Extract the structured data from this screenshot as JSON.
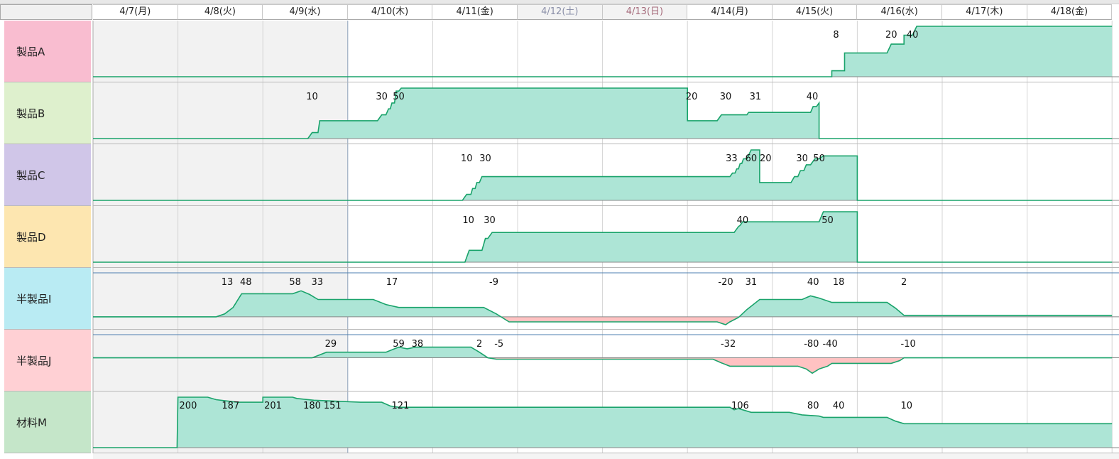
{
  "days": [
    {
      "label": "4/7(月)",
      "type": "weekday"
    },
    {
      "label": "4/8(火)",
      "type": "weekday"
    },
    {
      "label": "4/9(水)",
      "type": "weekday"
    },
    {
      "label": "4/10(木)",
      "type": "weekday"
    },
    {
      "label": "4/11(金)",
      "type": "weekday"
    },
    {
      "label": "4/12(土)",
      "type": "sat"
    },
    {
      "label": "4/13(日)",
      "type": "sun"
    },
    {
      "label": "4/14(月)",
      "type": "weekday"
    },
    {
      "label": "4/15(火)",
      "type": "weekday"
    },
    {
      "label": "4/16(水)",
      "type": "weekday"
    },
    {
      "label": "4/17(木)",
      "type": "weekday"
    },
    {
      "label": "4/18(金)",
      "type": "weekday"
    }
  ],
  "past_days": 3,
  "colors": {
    "positive_fill": "#ade5d6",
    "negative_fill": "#ffc2c2",
    "line": "#1aa36b",
    "past_bg": "#f2f2f2",
    "grid": "#d4d4d4"
  },
  "rows": [
    {
      "id": "product-a",
      "name": "製品A",
      "color": "#f9bdd0",
      "baseline_zero": true,
      "series": [
        [
          0,
          0
        ],
        [
          8.7,
          0
        ],
        [
          8.7,
          1
        ],
        [
          8.85,
          1
        ],
        [
          8.85,
          4
        ],
        [
          9.35,
          4
        ],
        [
          9.4,
          5.5
        ],
        [
          9.55,
          5.5
        ],
        [
          9.55,
          7
        ],
        [
          9.65,
          7
        ],
        [
          9.7,
          8.5
        ],
        [
          12,
          8.5
        ]
      ],
      "labels": [
        {
          "t": "8",
          "x": 8.75,
          "v": 8.5
        },
        {
          "t": "20",
          "x": 9.4,
          "v": 8.5
        },
        {
          "t": "40",
          "x": 9.65,
          "v": 8.5
        }
      ]
    },
    {
      "id": "product-b",
      "name": "製品B",
      "color": "#def0cd",
      "baseline_zero": true,
      "series": [
        [
          0,
          0
        ],
        [
          2.53,
          0
        ],
        [
          2.58,
          1
        ],
        [
          2.65,
          1
        ],
        [
          2.67,
          3
        ],
        [
          3.35,
          3
        ],
        [
          3.4,
          4
        ],
        [
          3.45,
          4
        ],
        [
          3.48,
          5
        ],
        [
          3.5,
          5
        ],
        [
          3.52,
          6
        ],
        [
          3.55,
          6
        ],
        [
          3.57,
          8
        ],
        [
          3.6,
          8
        ],
        [
          3.63,
          8.5
        ],
        [
          7,
          8.5
        ],
        [
          7,
          3
        ],
        [
          7.35,
          3
        ],
        [
          7.4,
          4
        ],
        [
          7.7,
          4
        ],
        [
          7.72,
          4.4
        ],
        [
          8.45,
          4.4
        ],
        [
          8.48,
          5.4
        ],
        [
          8.52,
          5.4
        ],
        [
          8.55,
          6
        ],
        [
          8.55,
          0
        ],
        [
          12,
          0
        ]
      ],
      "labels": [
        {
          "t": "10",
          "x": 2.58,
          "v": 8.5
        },
        {
          "t": "30",
          "x": 3.4,
          "v": 8.5
        },
        {
          "t": "50",
          "x": 3.6,
          "v": 8.5
        },
        {
          "t": "20",
          "x": 7.05,
          "v": 8.5
        },
        {
          "t": "30",
          "x": 7.45,
          "v": 8.5
        },
        {
          "t": "31",
          "x": 7.8,
          "v": 8.5
        },
        {
          "t": "40",
          "x": 8.47,
          "v": 8.5
        }
      ]
    },
    {
      "id": "product-c",
      "name": "製品C",
      "color": "#d0c6e8",
      "baseline_zero": true,
      "series": [
        [
          0,
          0
        ],
        [
          4.35,
          0
        ],
        [
          4.4,
          1
        ],
        [
          4.45,
          1
        ],
        [
          4.47,
          2
        ],
        [
          4.5,
          2
        ],
        [
          4.52,
          3
        ],
        [
          4.55,
          3
        ],
        [
          4.58,
          4
        ],
        [
          7.5,
          4
        ],
        [
          7.53,
          4.6
        ],
        [
          7.56,
          4.6
        ],
        [
          7.58,
          5.3
        ],
        [
          7.6,
          5.3
        ],
        [
          7.62,
          6.2
        ],
        [
          7.64,
          6.2
        ],
        [
          7.66,
          7
        ],
        [
          7.7,
          7
        ],
        [
          7.75,
          8.5
        ],
        [
          7.85,
          8.5
        ],
        [
          7.85,
          3
        ],
        [
          8.22,
          3
        ],
        [
          8.26,
          4
        ],
        [
          8.3,
          4
        ],
        [
          8.33,
          5
        ],
        [
          8.37,
          5
        ],
        [
          8.4,
          6
        ],
        [
          8.45,
          6
        ],
        [
          8.5,
          7
        ],
        [
          8.55,
          7
        ],
        [
          8.6,
          7.5
        ],
        [
          9,
          7.5
        ],
        [
          9,
          0
        ],
        [
          12,
          0
        ]
      ],
      "labels": [
        {
          "t": "10",
          "x": 4.4,
          "v": 8.5
        },
        {
          "t": "30",
          "x": 4.62,
          "v": 8.5
        },
        {
          "t": "33",
          "x": 7.52,
          "v": 8.5
        },
        {
          "t": "60",
          "x": 7.75,
          "v": 8.5
        },
        {
          "t": "20",
          "x": 7.92,
          "v": 8.5
        },
        {
          "t": "30",
          "x": 8.35,
          "v": 8.5
        },
        {
          "t": "50",
          "x": 8.55,
          "v": 8.5
        }
      ]
    },
    {
      "id": "product-d",
      "name": "製品D",
      "color": "#fde6b0",
      "baseline_zero": true,
      "series": [
        [
          0,
          0
        ],
        [
          4.38,
          0
        ],
        [
          4.43,
          2
        ],
        [
          4.58,
          2
        ],
        [
          4.62,
          4
        ],
        [
          4.65,
          4
        ],
        [
          4.7,
          5
        ],
        [
          7.55,
          5
        ],
        [
          7.6,
          6
        ],
        [
          7.62,
          6.2
        ],
        [
          7.65,
          6.8
        ],
        [
          8.55,
          6.8
        ],
        [
          8.6,
          8.5
        ],
        [
          9,
          8.5
        ],
        [
          9,
          0
        ],
        [
          12,
          0
        ]
      ],
      "labels": [
        {
          "t": "10",
          "x": 4.42,
          "v": 8.5
        },
        {
          "t": "30",
          "x": 4.67,
          "v": 8.5
        },
        {
          "t": "40",
          "x": 7.65,
          "v": 8.5
        },
        {
          "t": "50",
          "x": 8.65,
          "v": 8.5
        }
      ]
    },
    {
      "id": "semi-i",
      "name": "半製品I",
      "color": "#b9ebf3",
      "baseline_zero": false,
      "vmin": -10,
      "vmax": 60,
      "series": [
        [
          0,
          0
        ],
        [
          1.45,
          0
        ],
        [
          1.55,
          4
        ],
        [
          1.65,
          13
        ],
        [
          1.75,
          32
        ],
        [
          2.35,
          32
        ],
        [
          2.45,
          36
        ],
        [
          2.55,
          31
        ],
        [
          2.65,
          24
        ],
        [
          3.3,
          24
        ],
        [
          3.45,
          17
        ],
        [
          3.6,
          13
        ],
        [
          4.6,
          13
        ],
        [
          4.75,
          4
        ],
        [
          4.9,
          -7
        ],
        [
          7.35,
          -7
        ],
        [
          7.4,
          -9
        ],
        [
          7.45,
          -11
        ],
        [
          7.5,
          -7
        ],
        [
          7.6,
          -1
        ],
        [
          7.7,
          10
        ],
        [
          7.85,
          24
        ],
        [
          8.35,
          24
        ],
        [
          8.45,
          29
        ],
        [
          8.55,
          26
        ],
        [
          8.7,
          20
        ],
        [
          9.35,
          20
        ],
        [
          9.45,
          12
        ],
        [
          9.55,
          2
        ],
        [
          12,
          2
        ]
      ],
      "labels": [
        {
          "t": "13",
          "x": 1.58,
          "v": 60
        },
        {
          "t": "48",
          "x": 1.8,
          "v": 60
        },
        {
          "t": "58",
          "x": 2.38,
          "v": 60
        },
        {
          "t": "33",
          "x": 2.64,
          "v": 60
        },
        {
          "t": "17",
          "x": 3.52,
          "v": 60
        },
        {
          "t": "-9",
          "x": 4.72,
          "v": 60
        },
        {
          "t": "-20",
          "x": 7.45,
          "v": 60
        },
        {
          "t": "31",
          "x": 7.75,
          "v": 60
        },
        {
          "t": "40",
          "x": 8.48,
          "v": 60
        },
        {
          "t": "18",
          "x": 8.78,
          "v": 60
        },
        {
          "t": "2",
          "x": 9.55,
          "v": 60
        }
      ]
    },
    {
      "id": "semi-j",
      "name": "半製品J",
      "color": "#ffd0d4",
      "baseline_zero": false,
      "vmin": -100,
      "vmax": 80,
      "series": [
        [
          0,
          0
        ],
        [
          2.58,
          0
        ],
        [
          2.75,
          20
        ],
        [
          3.45,
          20
        ],
        [
          3.55,
          32
        ],
        [
          3.6,
          38
        ],
        [
          3.7,
          32
        ],
        [
          3.8,
          38
        ],
        [
          4.45,
          38
        ],
        [
          4.55,
          20
        ],
        [
          4.65,
          0
        ],
        [
          4.75,
          -5
        ],
        [
          7.3,
          -5
        ],
        [
          7.4,
          -18
        ],
        [
          7.5,
          -30
        ],
        [
          8.3,
          -30
        ],
        [
          8.4,
          -40
        ],
        [
          8.47,
          -55
        ],
        [
          8.55,
          -40
        ],
        [
          8.65,
          -30
        ],
        [
          8.7,
          -20
        ],
        [
          9.4,
          -20
        ],
        [
          9.5,
          -10
        ],
        [
          9.55,
          0
        ],
        [
          12,
          0
        ]
      ],
      "labels": [
        {
          "t": "29",
          "x": 2.8,
          "v": 80
        },
        {
          "t": "59",
          "x": 3.6,
          "v": 80
        },
        {
          "t": "38",
          "x": 3.82,
          "v": 80
        },
        {
          "t": "2",
          "x": 4.55,
          "v": 80
        },
        {
          "t": "-5",
          "x": 4.78,
          "v": 80
        },
        {
          "t": "-32",
          "x": 7.48,
          "v": 80
        },
        {
          "t": "-80",
          "x": 8.46,
          "v": 80
        },
        {
          "t": "-40",
          "x": 8.68,
          "v": 80
        },
        {
          "t": "-10",
          "x": 9.6,
          "v": 80
        }
      ]
    },
    {
      "id": "material-m",
      "name": "材料M",
      "color": "#c5e6c9",
      "baseline_zero": true,
      "vmin": 0,
      "vmax": 200,
      "series": [
        [
          0,
          0
        ],
        [
          0.99,
          0
        ],
        [
          1,
          200
        ],
        [
          1.35,
          200
        ],
        [
          1.45,
          190
        ],
        [
          1.7,
          180
        ],
        [
          2.0,
          180
        ],
        [
          2.0,
          200
        ],
        [
          2.35,
          200
        ],
        [
          2.4,
          195
        ],
        [
          2.6,
          188
        ],
        [
          3.15,
          180
        ],
        [
          3.4,
          180
        ],
        [
          3.5,
          165
        ],
        [
          3.6,
          160
        ],
        [
          7.5,
          160
        ],
        [
          7.55,
          150
        ],
        [
          7.6,
          155
        ],
        [
          7.75,
          140
        ],
        [
          8.2,
          140
        ],
        [
          8.35,
          130
        ],
        [
          8.55,
          125
        ],
        [
          8.6,
          120
        ],
        [
          9.35,
          120
        ],
        [
          9.45,
          105
        ],
        [
          9.55,
          95
        ],
        [
          12,
          95
        ]
      ],
      "labels": [
        {
          "t": "200",
          "x": 1.12,
          "v": 200
        },
        {
          "t": "187",
          "x": 1.62,
          "v": 200
        },
        {
          "t": "201",
          "x": 2.12,
          "v": 200
        },
        {
          "t": "180",
          "x": 2.58,
          "v": 200
        },
        {
          "t": "151",
          "x": 2.82,
          "v": 200
        },
        {
          "t": "121",
          "x": 3.62,
          "v": 200
        },
        {
          "t": "106",
          "x": 7.62,
          "v": 200
        },
        {
          "t": "80",
          "x": 8.48,
          "v": 200
        },
        {
          "t": "40",
          "x": 8.78,
          "v": 200
        },
        {
          "t": "10",
          "x": 9.58,
          "v": 200
        }
      ]
    }
  ]
}
